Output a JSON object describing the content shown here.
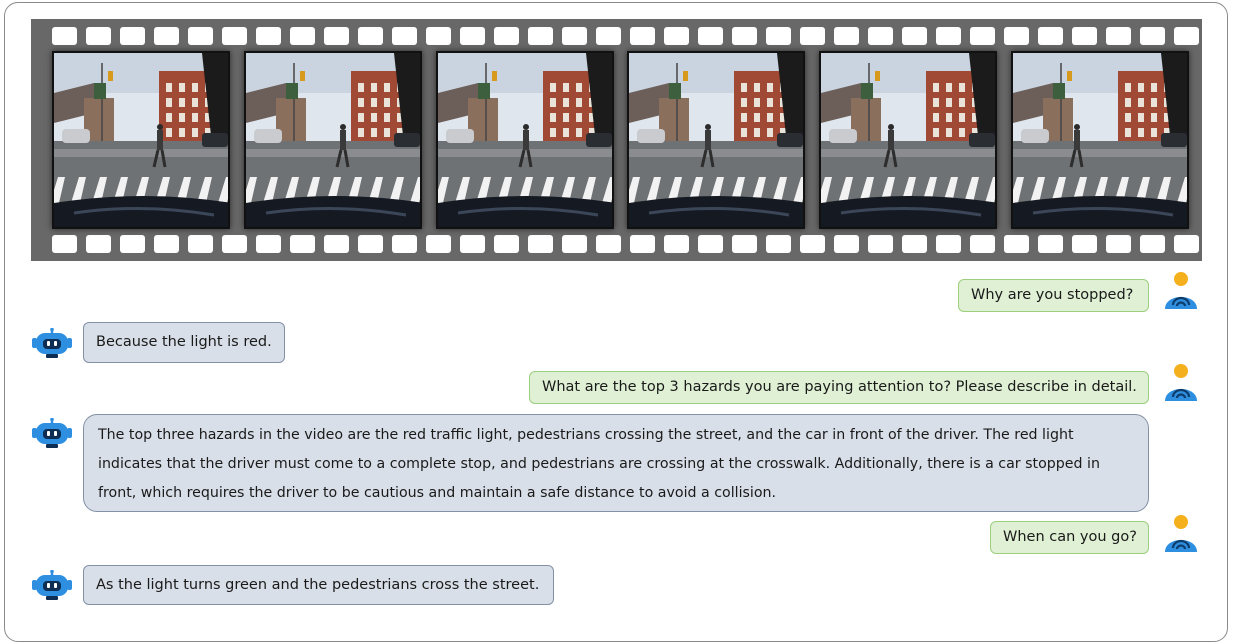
{
  "conversation": [
    {
      "role": "user",
      "text": "Why are you stopped?"
    },
    {
      "role": "assistant",
      "text": "Because the light is red."
    },
    {
      "role": "user",
      "text": "What are the top 3 hazards you are paying attention to? Please describe in detail."
    },
    {
      "role": "assistant",
      "text": "The top three hazards in the video are the red traffic light, pedestrians crossing the street, and the car in front of the driver. The red light indicates that the driver must come to a complete stop, and pedestrians are crossing at the crosswalk. Additionally, there is a car stopped in front, which requires the driver to be cautious and maintain a safe distance to avoid a collision."
    },
    {
      "role": "user",
      "text": "When can you go?"
    },
    {
      "role": "assistant",
      "text": "As the light turns green and the pedestrians cross the street."
    }
  ],
  "filmstrip": {
    "frame_count": 6,
    "pedestrian_position": [
      0.42,
      0.33,
      0.24,
      0.15,
      0.06,
      0.0
    ],
    "icons": {
      "user": "user-icon",
      "assistant": "robot-icon"
    }
  },
  "colors": {
    "user_bubble": "#dff0d4",
    "user_border": "#9ccf7d",
    "bot_bubble": "#d9dfe8",
    "bot_border": "#8391a6",
    "film": "#686868",
    "icon_blue": "#2e8fe0",
    "icon_orange": "#f5b01e"
  }
}
